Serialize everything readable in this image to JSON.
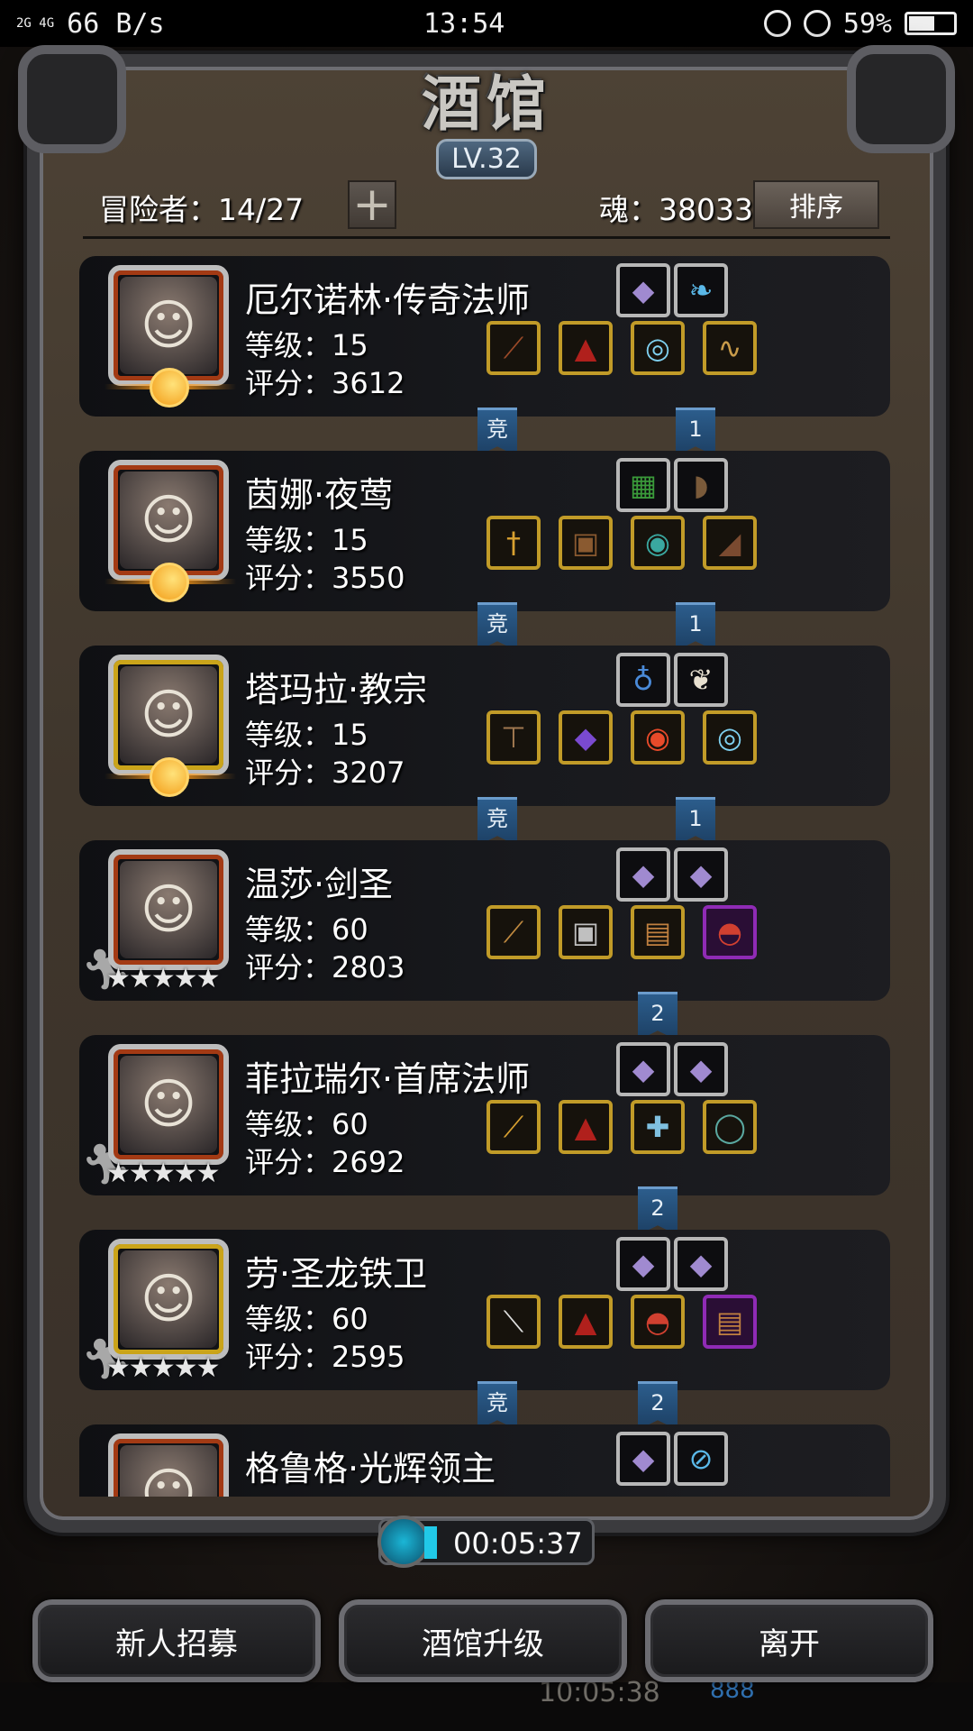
{
  "status_bar": {
    "network": "2G 4G",
    "speed": "66 B/s",
    "time": "13:54",
    "battery": "59%",
    "battery_level": 0.59
  },
  "header": {
    "title": "酒馆",
    "level": "LV.32",
    "adventurers": "冒险者：14/27",
    "plus_label": "+",
    "soul": "魂：38033",
    "sort_label": "排序"
  },
  "heroes": [
    {
      "name": "厄尔诺林·传奇法师",
      "level": "等级：15",
      "score": "评分：3612",
      "frame": "red",
      "marker": "moon",
      "portrait_icon": "elf-mage-portrait",
      "top_slots": [
        {
          "icon": "crystal-icon",
          "glyph": "◆",
          "color": "#a08ad0",
          "border": "silver"
        },
        {
          "icon": "blue-bird-icon",
          "glyph": "❧",
          "color": "#5ab8e8",
          "border": "silver"
        }
      ],
      "bottom_slots": [
        {
          "icon": "staff-icon",
          "glyph": "⟋",
          "color": "#9b4a28",
          "border": "gold"
        },
        {
          "icon": "robe-icon",
          "glyph": "▲",
          "color": "#b0201c",
          "border": "gold"
        },
        {
          "icon": "ring-icon",
          "glyph": "◎",
          "color": "#7fd0f0",
          "border": "gold"
        },
        {
          "icon": "necklace-icon",
          "glyph": "∿",
          "color": "#c89b4a",
          "border": "gold"
        }
      ],
      "tag_left": "竞",
      "tag_right": "1"
    },
    {
      "name": "茵娜·夜莺",
      "level": "等级：15",
      "score": "评分：3550",
      "frame": "red",
      "marker": "moon",
      "portrait_icon": "dark-elf-portrait",
      "top_slots": [
        {
          "icon": "green-tome-icon",
          "glyph": "▦",
          "color": "#3a9a3a",
          "border": "silver"
        },
        {
          "icon": "gauntlet-icon",
          "glyph": "◗",
          "color": "#7a5a3a",
          "border": "silver"
        }
      ],
      "bottom_slots": [
        {
          "icon": "dagger-icon",
          "glyph": "†",
          "color": "#d8a030",
          "border": "gold"
        },
        {
          "icon": "leather-armor-icon",
          "glyph": "▣",
          "color": "#8a5a30",
          "border": "gold"
        },
        {
          "icon": "emerald-ring-icon",
          "glyph": "◉",
          "color": "#3aa8a0",
          "border": "gold"
        },
        {
          "icon": "boots-icon",
          "glyph": "◢",
          "color": "#7a4a30",
          "border": "gold"
        }
      ],
      "tag_left": "竞",
      "tag_right": "1"
    },
    {
      "name": "塔玛拉·教宗",
      "level": "等级：15",
      "score": "评分：3207",
      "frame": "gold",
      "marker": "moon",
      "portrait_icon": "priestess-portrait",
      "top_slots": [
        {
          "icon": "amulet-icon",
          "glyph": "♁",
          "color": "#4a8ad8",
          "border": "silver"
        },
        {
          "icon": "feather-icon",
          "glyph": "❦",
          "color": "#e8e0d0",
          "border": "silver"
        }
      ],
      "bottom_slots": [
        {
          "icon": "hammer-icon",
          "glyph": "⊤",
          "color": "#a07850",
          "border": "gold"
        },
        {
          "icon": "purple-armor-icon",
          "glyph": "◆",
          "color": "#7a4ad0",
          "border": "gold"
        },
        {
          "icon": "ruby-ring-icon",
          "glyph": "◉",
          "color": "#e84a2a",
          "border": "gold"
        },
        {
          "icon": "ring-icon",
          "glyph": "◎",
          "color": "#7fd0f0",
          "border": "gold"
        }
      ],
      "tag_left": "竞",
      "tag_right": "1"
    },
    {
      "name": "温莎·剑圣",
      "level": "等级：60",
      "score": "评分：2803",
      "frame": "red",
      "marker": "stars",
      "stars": "★★★★★",
      "portrait_icon": "hooded-woman-portrait",
      "top_slots": [
        {
          "icon": "crystal-icon",
          "glyph": "◆",
          "color": "#a08ad0",
          "border": "silver"
        },
        {
          "icon": "crystal-icon",
          "glyph": "◆",
          "color": "#a08ad0",
          "border": "silver"
        }
      ],
      "bottom_slots": [
        {
          "icon": "sword-icon",
          "glyph": "⟋",
          "color": "#c08a40",
          "border": "gold"
        },
        {
          "icon": "chest-armor-icon",
          "glyph": "▣",
          "color": "#c0c0c0",
          "border": "gold"
        },
        {
          "icon": "scroll-icon",
          "glyph": "▤",
          "color": "#c08040",
          "border": "gold"
        },
        {
          "icon": "helmet-icon",
          "glyph": "◓",
          "color": "#d04030",
          "border": "purple"
        }
      ],
      "tag_left": "",
      "tag_right": "2"
    },
    {
      "name": "菲拉瑞尔·首席法师",
      "level": "等级：60",
      "score": "评分：2692",
      "frame": "red",
      "marker": "stars",
      "stars": "★★★★★",
      "portrait_icon": "hooded-mage-portrait",
      "top_slots": [
        {
          "icon": "crystal-icon",
          "glyph": "◆",
          "color": "#a08ad0",
          "border": "silver"
        },
        {
          "icon": "crystal-icon",
          "glyph": "◆",
          "color": "#a08ad0",
          "border": "silver"
        }
      ],
      "bottom_slots": [
        {
          "icon": "golden-staff-icon",
          "glyph": "⟋",
          "color": "#d8a030",
          "border": "gold"
        },
        {
          "icon": "robe-icon",
          "glyph": "▲",
          "color": "#b0201c",
          "border": "gold"
        },
        {
          "icon": "cross-amulet-icon",
          "glyph": "✚",
          "color": "#7fc0e0",
          "border": "gold"
        },
        {
          "icon": "jade-ring-icon",
          "glyph": "◯",
          "color": "#5aa8a0",
          "border": "gold"
        }
      ],
      "tag_left": "",
      "tag_right": "2"
    },
    {
      "name": "劳·圣龙铁卫",
      "level": "等级：60",
      "score": "评分：2595",
      "frame": "gold",
      "marker": "stars",
      "stars": "★★★★★",
      "portrait_icon": "bearded-warrior-portrait",
      "top_slots": [
        {
          "icon": "crystal-icon",
          "glyph": "◆",
          "color": "#a08ad0",
          "border": "silver"
        },
        {
          "icon": "crystal-icon",
          "glyph": "◆",
          "color": "#a08ad0",
          "border": "silver"
        }
      ],
      "bottom_slots": [
        {
          "icon": "greatsword-icon",
          "glyph": "⟍",
          "color": "#e0e0e0",
          "border": "gold"
        },
        {
          "icon": "robe-icon",
          "glyph": "▲",
          "color": "#b0201c",
          "border": "gold"
        },
        {
          "icon": "helmet-icon",
          "glyph": "◓",
          "color": "#d04030",
          "border": "gold"
        },
        {
          "icon": "scroll-icon",
          "glyph": "▤",
          "color": "#c08040",
          "border": "purple"
        }
      ],
      "tag_left": "竞",
      "tag_right": "2"
    },
    {
      "name": "格鲁格·光辉领主",
      "level": "",
      "score": "",
      "frame": "red",
      "marker": "none",
      "portrait_icon": "dark-warrior-portrait",
      "top_slots": [
        {
          "icon": "crystal-icon",
          "glyph": "◆",
          "color": "#a08ad0",
          "border": "silver"
        },
        {
          "icon": "bracer-icon",
          "glyph": "⊘",
          "color": "#5ab8e8",
          "border": "silver"
        }
      ],
      "bottom_slots": [],
      "tag_left": "",
      "tag_right": ""
    }
  ],
  "timer": "00:05:37",
  "buttons": {
    "recruit": "新人招募",
    "upgrade": "酒馆升级",
    "leave": "离开"
  },
  "background_text": {
    "time": "10:05:38",
    "number": "888"
  }
}
